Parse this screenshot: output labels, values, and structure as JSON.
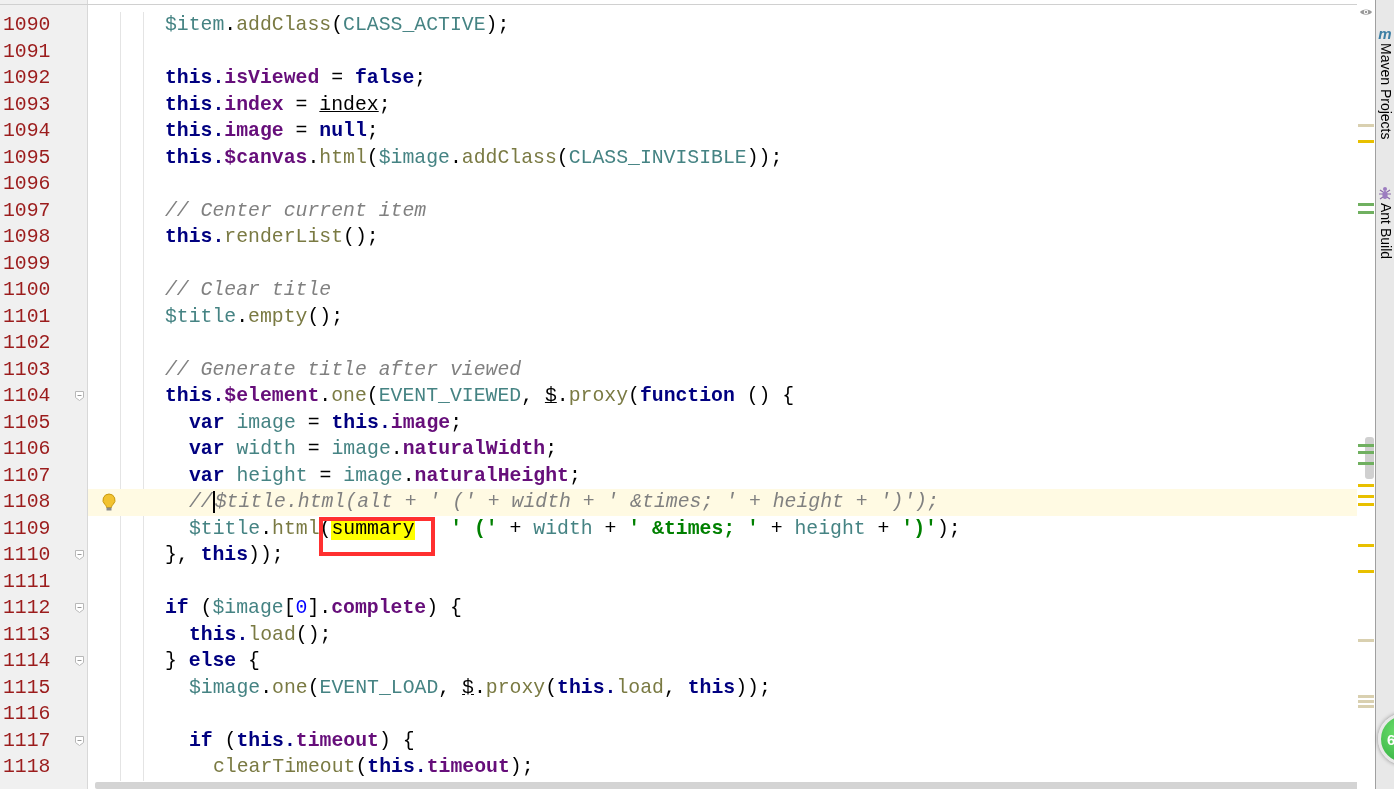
{
  "editor": {
    "lines": [
      {
        "number": "1090",
        "current": false,
        "foldable": false,
        "bulb": false,
        "kind": "block",
        "tokens": [
          {
            "text": "$item",
            "kind": "local"
          },
          {
            "text": ".",
            "kind": "plain"
          },
          {
            "text": "addClass",
            "kind": "method"
          },
          {
            "text": "(",
            "kind": "plain"
          },
          {
            "text": "CLASS_ACTIVE",
            "kind": "local"
          },
          {
            "text": ");",
            "kind": "plain"
          }
        ]
      },
      {
        "number": "1091",
        "current": false,
        "foldable": false,
        "bulb": false
      },
      {
        "number": "1092",
        "current": false,
        "foldable": false,
        "bulb": false,
        "kind": "block",
        "tokens": [
          {
            "text": "this.",
            "kind": "kw"
          },
          {
            "text": "isViewed",
            "kind": "field"
          },
          {
            "text": " = ",
            "kind": "plain"
          },
          {
            "text": "false",
            "kind": "kw"
          },
          {
            "text": ";",
            "kind": "plain"
          }
        ]
      },
      {
        "number": "1093",
        "current": false,
        "foldable": false,
        "bulb": false,
        "kind": "block",
        "tokens": [
          {
            "text": "this.",
            "kind": "kw"
          },
          {
            "text": "index",
            "kind": "field"
          },
          {
            "text": " = ",
            "kind": "plain"
          },
          {
            "text": "index",
            "kind": "param"
          },
          {
            "text": ";",
            "kind": "plain"
          }
        ]
      },
      {
        "number": "1094",
        "current": false,
        "foldable": false,
        "bulb": false,
        "kind": "block",
        "tokens": [
          {
            "text": "this.",
            "kind": "kw"
          },
          {
            "text": "image",
            "kind": "field"
          },
          {
            "text": " = ",
            "kind": "plain"
          },
          {
            "text": "null",
            "kind": "kw"
          },
          {
            "text": ";",
            "kind": "plain"
          }
        ]
      },
      {
        "number": "1095",
        "current": false,
        "foldable": false,
        "bulb": false,
        "kind": "block",
        "tokens": [
          {
            "text": "this.",
            "kind": "kw"
          },
          {
            "text": "$canvas",
            "kind": "field"
          },
          {
            "text": ".",
            "kind": "plain"
          },
          {
            "text": "html",
            "kind": "method"
          },
          {
            "text": "(",
            "kind": "plain"
          },
          {
            "text": "$image",
            "kind": "local"
          },
          {
            "text": ".",
            "kind": "plain"
          },
          {
            "text": "addClass",
            "kind": "method"
          },
          {
            "text": "(",
            "kind": "plain"
          },
          {
            "text": "CLASS_INVISIBLE",
            "kind": "local"
          },
          {
            "text": "));",
            "kind": "plain"
          }
        ]
      },
      {
        "number": "1096",
        "current": false,
        "foldable": false,
        "bulb": false
      },
      {
        "number": "1097",
        "current": false,
        "foldable": false,
        "bulb": false,
        "kind": "block",
        "tokens": [
          {
            "text": "// Center current item",
            "kind": "comment"
          }
        ]
      },
      {
        "number": "1098",
        "current": false,
        "foldable": false,
        "bulb": false,
        "kind": "block",
        "tokens": [
          {
            "text": "this.",
            "kind": "kw"
          },
          {
            "text": "renderList",
            "kind": "method"
          },
          {
            "text": "();",
            "kind": "plain"
          }
        ]
      },
      {
        "number": "1099",
        "current": false,
        "foldable": false,
        "bulb": false
      },
      {
        "number": "1100",
        "current": false,
        "foldable": false,
        "bulb": false,
        "kind": "block",
        "tokens": [
          {
            "text": "// Clear title",
            "kind": "comment"
          }
        ]
      },
      {
        "number": "1101",
        "current": false,
        "foldable": false,
        "bulb": false,
        "kind": "block",
        "tokens": [
          {
            "text": "$title",
            "kind": "local"
          },
          {
            "text": ".",
            "kind": "plain"
          },
          {
            "text": "empty",
            "kind": "method"
          },
          {
            "text": "();",
            "kind": "plain"
          }
        ]
      },
      {
        "number": "1102",
        "current": false,
        "foldable": false,
        "bulb": false
      },
      {
        "number": "1103",
        "current": false,
        "foldable": false,
        "bulb": false,
        "kind": "block",
        "tokens": [
          {
            "text": "// Generate title after viewed",
            "kind": "comment"
          }
        ]
      },
      {
        "number": "1104",
        "current": false,
        "foldable": true,
        "bulb": false,
        "kind": "block",
        "tokens": [
          {
            "text": "this.",
            "kind": "kw"
          },
          {
            "text": "$element",
            "kind": "field"
          },
          {
            "text": ".",
            "kind": "plain"
          },
          {
            "text": "one",
            "kind": "method"
          },
          {
            "text": "(",
            "kind": "plain"
          },
          {
            "text": "EVENT_VIEWED",
            "kind": "local"
          },
          {
            "text": ", ",
            "kind": "plain"
          },
          {
            "text": "$",
            "kind": "param"
          },
          {
            "text": ".",
            "kind": "plain"
          },
          {
            "text": "proxy",
            "kind": "method"
          },
          {
            "text": "(",
            "kind": "plain"
          },
          {
            "text": "function",
            "kind": "kw"
          },
          {
            "text": " () {",
            "kind": "plain"
          }
        ]
      },
      {
        "number": "1105",
        "current": false,
        "foldable": false,
        "bulb": false,
        "kind": "nested",
        "tokens": [
          {
            "text": "var ",
            "kind": "kw"
          },
          {
            "text": "image",
            "kind": "local"
          },
          {
            "text": " = ",
            "kind": "plain"
          },
          {
            "text": "this.",
            "kind": "kw"
          },
          {
            "text": "image",
            "kind": "field"
          },
          {
            "text": ";",
            "kind": "plain"
          }
        ]
      },
      {
        "number": "1106",
        "current": false,
        "foldable": false,
        "bulb": false,
        "kind": "nested",
        "tokens": [
          {
            "text": "var ",
            "kind": "kw"
          },
          {
            "text": "width",
            "kind": "local"
          },
          {
            "text": " = ",
            "kind": "plain"
          },
          {
            "text": "image",
            "kind": "local"
          },
          {
            "text": ".",
            "kind": "plain"
          },
          {
            "text": "naturalWidth",
            "kind": "field"
          },
          {
            "text": ";",
            "kind": "plain"
          }
        ]
      },
      {
        "number": "1107",
        "current": false,
        "foldable": false,
        "bulb": false,
        "kind": "nested",
        "tokens": [
          {
            "text": "var ",
            "kind": "kw"
          },
          {
            "text": "height",
            "kind": "local"
          },
          {
            "text": " = ",
            "kind": "plain"
          },
          {
            "text": "image",
            "kind": "local"
          },
          {
            "text": ".",
            "kind": "plain"
          },
          {
            "text": "naturalHeight",
            "kind": "field"
          },
          {
            "text": ";",
            "kind": "plain"
          }
        ]
      },
      {
        "number": "1108",
        "current": true,
        "foldable": false,
        "bulb": true,
        "kind": "nested",
        "tokens": [
          {
            "text": "//",
            "kind": "comment"
          },
          {
            "text": "$title.html(alt + ' (' + width + ' &times; ' + height + ')');",
            "kind": "comment"
          }
        ]
      },
      {
        "number": "1109",
        "current": false,
        "foldable": false,
        "bulb": false,
        "kind": "nested",
        "tokens": [
          {
            "text": "$title",
            "kind": "local"
          },
          {
            "text": ".",
            "kind": "plain"
          },
          {
            "text": "html",
            "kind": "method"
          },
          {
            "text": "(",
            "kind": "plain"
          },
          {
            "text": "summary",
            "kind": "boxed_match"
          },
          {
            "text": "   ' ('",
            "kind": "string"
          },
          {
            "text": " + ",
            "kind": "plain"
          },
          {
            "text": "width",
            "kind": "local"
          },
          {
            "text": " + ",
            "kind": "plain"
          },
          {
            "text": "' &times; '",
            "kind": "string"
          },
          {
            "text": " + ",
            "kind": "plain"
          },
          {
            "text": "height",
            "kind": "local"
          },
          {
            "text": " + ",
            "kind": "plain"
          },
          {
            "text": "')'",
            "kind": "string"
          },
          {
            "text": ");",
            "kind": "plain"
          }
        ]
      },
      {
        "number": "1110",
        "current": false,
        "foldable": true,
        "bulb": false,
        "kind": "block",
        "tokens": [
          {
            "text": "}, ",
            "kind": "plain"
          },
          {
            "text": "this",
            "kind": "kw"
          },
          {
            "text": "));",
            "kind": "plain"
          }
        ]
      },
      {
        "number": "1111",
        "current": false,
        "foldable": false,
        "bulb": false
      },
      {
        "number": "1112",
        "current": false,
        "foldable": true,
        "bulb": false,
        "kind": "block",
        "tokens": [
          {
            "text": "if",
            "kind": "kw"
          },
          {
            "text": " (",
            "kind": "plain"
          },
          {
            "text": "$image",
            "kind": "local"
          },
          {
            "text": "[",
            "kind": "plain"
          },
          {
            "text": "0",
            "kind": "number"
          },
          {
            "text": "].",
            "kind": "plain"
          },
          {
            "text": "complete",
            "kind": "field"
          },
          {
            "text": ") {",
            "kind": "plain"
          }
        ]
      },
      {
        "number": "1113",
        "current": false,
        "foldable": false,
        "bulb": false,
        "kind": "nested",
        "tokens": [
          {
            "text": "this.",
            "kind": "kw"
          },
          {
            "text": "load",
            "kind": "method"
          },
          {
            "text": "();",
            "kind": "plain"
          }
        ]
      },
      {
        "number": "1114",
        "current": false,
        "foldable": true,
        "bulb": false,
        "kind": "block",
        "tokens": [
          {
            "text": "} ",
            "kind": "plain"
          },
          {
            "text": "else",
            "kind": "kw"
          },
          {
            "text": " {",
            "kind": "plain"
          }
        ]
      },
      {
        "number": "1115",
        "current": false,
        "foldable": false,
        "bulb": false,
        "kind": "nested",
        "tokens": [
          {
            "text": "$image",
            "kind": "local"
          },
          {
            "text": ".",
            "kind": "plain"
          },
          {
            "text": "one",
            "kind": "method"
          },
          {
            "text": "(",
            "kind": "plain"
          },
          {
            "text": "EVENT_LOAD",
            "kind": "local"
          },
          {
            "text": ", ",
            "kind": "plain"
          },
          {
            "text": "$",
            "kind": "param"
          },
          {
            "text": ".",
            "kind": "plain"
          },
          {
            "text": "proxy",
            "kind": "method"
          },
          {
            "text": "(",
            "kind": "plain"
          },
          {
            "text": "this.",
            "kind": "kw"
          },
          {
            "text": "load",
            "kind": "method"
          },
          {
            "text": ", ",
            "kind": "plain"
          },
          {
            "text": "this",
            "kind": "kw"
          },
          {
            "text": "));",
            "kind": "plain"
          }
        ]
      },
      {
        "number": "1116",
        "current": false,
        "foldable": false,
        "bulb": false
      },
      {
        "number": "1117",
        "current": false,
        "foldable": true,
        "bulb": false,
        "kind": "nested",
        "tokens": [
          {
            "text": "if",
            "kind": "kw"
          },
          {
            "text": " (",
            "kind": "plain"
          },
          {
            "text": "this.",
            "kind": "kw"
          },
          {
            "text": "timeout",
            "kind": "field"
          },
          {
            "text": ") {",
            "kind": "plain"
          }
        ]
      },
      {
        "number": "1118",
        "current": false,
        "foldable": false,
        "bulb": false,
        "kind": "deep",
        "tokens": [
          {
            "text": "clearTimeout",
            "kind": "method"
          },
          {
            "text": "(",
            "kind": "plain"
          },
          {
            "text": "this.",
            "kind": "kw"
          },
          {
            "text": "timeout",
            "kind": "field"
          },
          {
            "text": ");",
            "kind": "plain"
          }
        ]
      }
    ]
  },
  "tool_windows": [
    {
      "kind": "maven",
      "icon_text": "m",
      "label": "Maven Projects"
    },
    {
      "kind": "ant",
      "label": "Ant Build"
    }
  ],
  "status_badge": {
    "text": "6"
  }
}
